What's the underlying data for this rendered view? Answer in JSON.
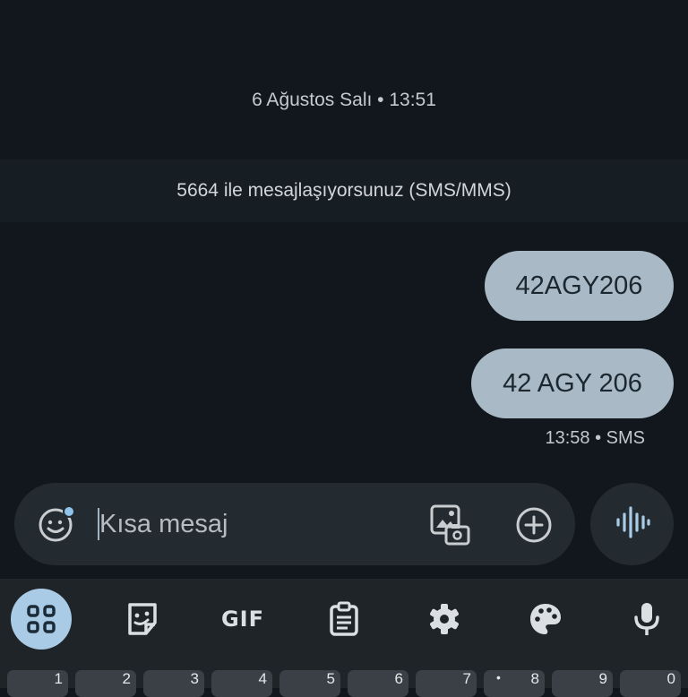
{
  "conversation": {
    "date_header": "6 Ağustos Salı • 13:51",
    "info_banner": "5664 ile mesajlaşıyorsunuz (SMS/MMS)",
    "messages": [
      {
        "text": "42AGY206",
        "direction": "outgoing"
      },
      {
        "text": "42 AGY 206",
        "direction": "outgoing"
      }
    ],
    "last_meta": "13:58 • SMS"
  },
  "composer": {
    "placeholder": "Kısa mesaj",
    "icons": [
      "emoji-icon",
      "gallery-icon",
      "plus-icon",
      "voice-icon"
    ]
  },
  "keyboard": {
    "toolbar": [
      "apps-icon",
      "sticker-icon",
      "GIF",
      "clipboard-icon",
      "settings-icon",
      "palette-icon",
      "mic-icon"
    ],
    "gif_label": "GIF",
    "number_keys": [
      "1",
      "2",
      "3",
      "4",
      "5",
      "6",
      "7",
      "8",
      "9",
      "0"
    ]
  },
  "colors": {
    "background": "#11171c",
    "bubble": "#a9bac6",
    "accent": "#a9cbe6",
    "composer": "#232b31"
  }
}
